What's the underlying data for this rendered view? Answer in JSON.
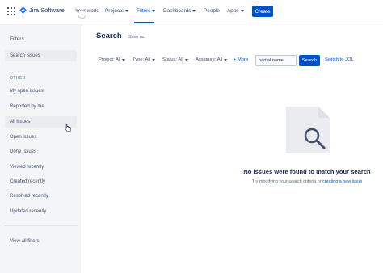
{
  "topnav": {
    "product": "Jira Software",
    "items": [
      {
        "label": "Your work",
        "dropdown": false,
        "active": false
      },
      {
        "label": "Projects",
        "dropdown": true,
        "active": false
      },
      {
        "label": "Filters",
        "dropdown": true,
        "active": true
      },
      {
        "label": "Dashboards",
        "dropdown": true,
        "active": false
      },
      {
        "label": "People",
        "dropdown": false,
        "active": false
      },
      {
        "label": "Apps",
        "dropdown": true,
        "active": false
      }
    ],
    "create_label": "Create"
  },
  "sidebar": {
    "title": "Filters",
    "collapse_icon": "chevron-left-icon",
    "search_issues": "Search issues",
    "section_header": "OTHER",
    "items": [
      "My open issues",
      "Reported by me",
      "All issues",
      "Open issues",
      "Done issues",
      "Viewed recently",
      "Created recently",
      "Resolved recently",
      "Updated recently"
    ],
    "view_all": "View all filters"
  },
  "main": {
    "title": "Search",
    "save_as": "Save as",
    "filters": {
      "project": "Project: All",
      "type": "Type: All",
      "status": "Status: All",
      "assignee": "Assignee: All",
      "more": "+ More"
    },
    "search_value": "partial name",
    "search_button": "Search",
    "switch_jql": "Switch to JQL",
    "empty_state": {
      "icon": "document-magnifier-icon",
      "title": "No issues were found to match your search",
      "subtitle_prefix": "Try modifying your search criteria or ",
      "subtitle_link": "creating a new issue"
    }
  },
  "colors": {
    "brand": "#0052cc",
    "text": "#172b4d",
    "sidebar_bg": "#f4f5f7"
  }
}
